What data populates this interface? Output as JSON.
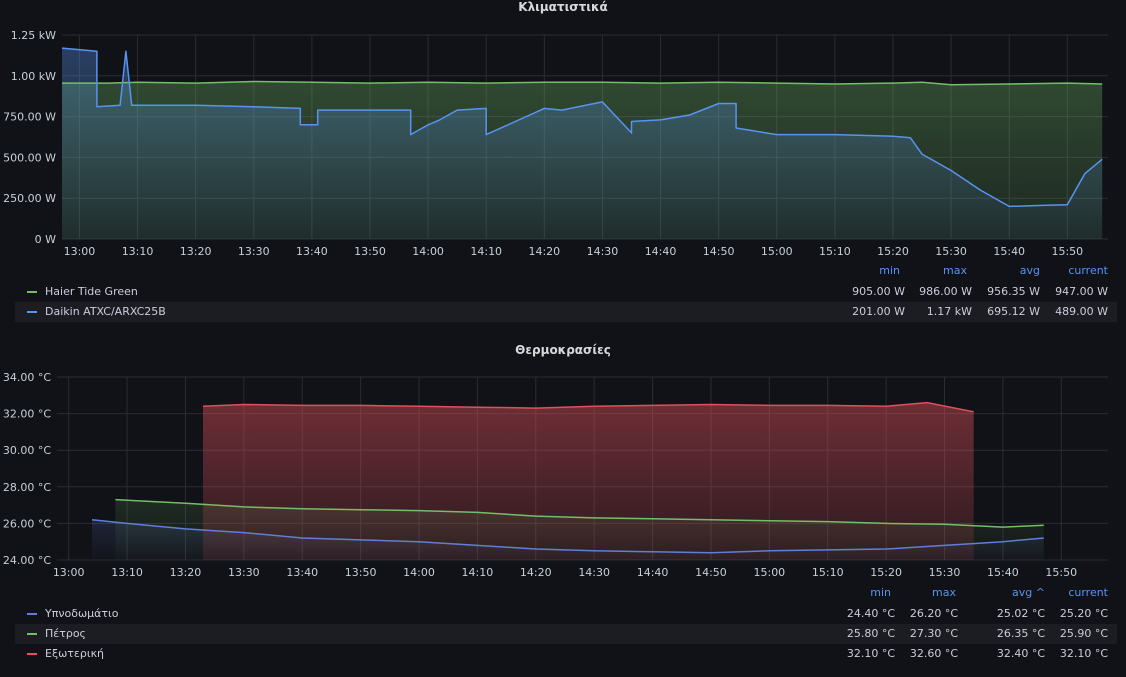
{
  "panels": {
    "power": {
      "title": "Κλιματιστικά",
      "y_ticks": [
        "1.25 kW",
        "1.00 kW",
        "750.00 W",
        "500.00 W",
        "250.00 W",
        "0 W"
      ],
      "x_ticks": [
        "13:00",
        "13:10",
        "13:20",
        "13:30",
        "13:40",
        "13:50",
        "14:00",
        "14:10",
        "14:20",
        "14:30",
        "14:40",
        "14:50",
        "15:00",
        "15:10",
        "15:20",
        "15:30",
        "15:40",
        "15:50"
      ],
      "legend_headers": {
        "min": "min",
        "max": "max",
        "avg": "avg",
        "current": "current"
      },
      "series": [
        {
          "name": "Haier Tide Green",
          "color": "#73bf69",
          "min": "905.00 W",
          "max": "986.00 W",
          "avg": "956.35 W",
          "current": "947.00 W"
        },
        {
          "name": "Daikin ATXC/ARXC25B",
          "color": "#5794f2",
          "min": "201.00 W",
          "max": "1.17 kW",
          "avg": "695.12 W",
          "current": "489.00 W"
        }
      ]
    },
    "temps": {
      "title": "Θερμοκρασίες",
      "y_ticks": [
        "34.00 °C",
        "32.00 °C",
        "30.00 °C",
        "28.00 °C",
        "26.00 °C",
        "24.00 °C"
      ],
      "x_ticks": [
        "13:00",
        "13:10",
        "13:20",
        "13:30",
        "13:40",
        "13:50",
        "14:00",
        "14:10",
        "14:20",
        "14:30",
        "14:40",
        "14:50",
        "15:00",
        "15:10",
        "15:20",
        "15:30",
        "15:40",
        "15:50"
      ],
      "legend_headers": {
        "min": "min",
        "max": "max",
        "avg": "avg ^",
        "current": "current"
      },
      "series": [
        {
          "name": "Υπνοδωμάτιο",
          "color": "#5f7fd6",
          "min": "24.40 °C",
          "max": "26.20 °C",
          "avg": "25.02 °C",
          "current": "25.20 °C"
        },
        {
          "name": "Πέτρος",
          "color": "#73bf69",
          "min": "25.80 °C",
          "max": "27.30 °C",
          "avg": "26.35 °C",
          "current": "25.90 °C"
        },
        {
          "name": "Εξωτερική",
          "color": "#e0505a",
          "min": "32.10 °C",
          "max": "32.60 °C",
          "avg": "32.40 °C",
          "current": "32.10 °C"
        }
      ]
    }
  },
  "chart_data": [
    {
      "type": "line",
      "title": "Κλιματιστικά",
      "ylim": [
        0,
        1250
      ],
      "x_unit": "time",
      "series": [
        {
          "name": "Haier Tide Green",
          "x": [
            "12:57",
            "13:05",
            "13:10",
            "13:20",
            "13:30",
            "13:40",
            "13:50",
            "14:00",
            "14:10",
            "14:20",
            "14:30",
            "14:40",
            "14:50",
            "15:00",
            "15:10",
            "15:20",
            "15:25",
            "15:30",
            "15:40",
            "15:50",
            "15:56"
          ],
          "values": [
            955,
            955,
            960,
            955,
            965,
            960,
            955,
            960,
            955,
            960,
            960,
            955,
            960,
            955,
            950,
            955,
            960,
            945,
            950,
            955,
            950
          ]
        },
        {
          "name": "Daikin ATXC/ARXC25B",
          "x": [
            "12:57",
            "13:03",
            "13:03",
            "13:07",
            "13:08",
            "13:09",
            "13:10",
            "13:20",
            "13:30",
            "13:38",
            "13:38",
            "13:41",
            "13:41",
            "13:50",
            "13:57",
            "13:57",
            "14:00",
            "14:02",
            "14:05",
            "14:10",
            "14:10",
            "14:15",
            "14:20",
            "14:23",
            "14:30",
            "14:35",
            "14:35",
            "14:40",
            "14:45",
            "14:50",
            "14:53",
            "14:53",
            "15:00",
            "15:10",
            "15:20",
            "15:23",
            "15:25",
            "15:30",
            "15:35",
            "15:40",
            "15:45",
            "15:50",
            "15:53",
            "15:56"
          ],
          "values": [
            1170,
            1150,
            810,
            820,
            1150,
            820,
            820,
            820,
            810,
            800,
            700,
            700,
            790,
            790,
            790,
            640,
            700,
            730,
            790,
            800,
            640,
            720,
            800,
            790,
            840,
            650,
            720,
            730,
            760,
            830,
            830,
            680,
            640,
            640,
            630,
            620,
            520,
            420,
            300,
            200,
            205,
            210,
            400,
            489
          ]
        }
      ]
    },
    {
      "type": "area",
      "title": "Θερμοκρασίες",
      "ylim": [
        24,
        34
      ],
      "series": [
        {
          "name": "Υπνοδωμάτιο",
          "x": [
            "13:04",
            "13:10",
            "13:20",
            "13:30",
            "13:40",
            "13:50",
            "14:00",
            "14:10",
            "14:20",
            "14:30",
            "14:40",
            "14:50",
            "15:00",
            "15:10",
            "15:20",
            "15:30",
            "15:40",
            "15:47"
          ],
          "values": [
            26.2,
            26.0,
            25.7,
            25.5,
            25.2,
            25.1,
            25.0,
            24.8,
            24.6,
            24.5,
            24.45,
            24.4,
            24.5,
            24.55,
            24.6,
            24.8,
            25.0,
            25.2
          ]
        },
        {
          "name": "Πέτρος",
          "x": [
            "13:08",
            "13:20",
            "13:30",
            "13:40",
            "13:50",
            "14:00",
            "14:10",
            "14:20",
            "14:30",
            "14:40",
            "14:50",
            "15:00",
            "15:10",
            "15:20",
            "15:30",
            "15:40",
            "15:47"
          ],
          "values": [
            27.3,
            27.1,
            26.9,
            26.8,
            26.75,
            26.7,
            26.6,
            26.4,
            26.3,
            26.25,
            26.2,
            26.15,
            26.1,
            26.0,
            25.95,
            25.8,
            25.9
          ]
        },
        {
          "name": "Εξωτερική",
          "x": [
            "13:23",
            "13:30",
            "13:40",
            "13:50",
            "14:00",
            "14:10",
            "14:20",
            "14:30",
            "14:40",
            "14:50",
            "15:00",
            "15:10",
            "15:20",
            "15:27",
            "15:35"
          ],
          "values": [
            32.4,
            32.5,
            32.45,
            32.45,
            32.4,
            32.35,
            32.3,
            32.4,
            32.45,
            32.5,
            32.45,
            32.45,
            32.4,
            32.6,
            32.1
          ]
        }
      ]
    }
  ]
}
